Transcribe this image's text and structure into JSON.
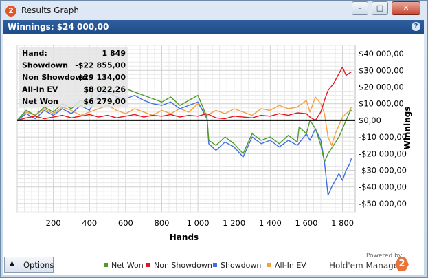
{
  "window": {
    "title": "Results Graph",
    "icon_text": "2",
    "minimize": "–",
    "maximize": "□",
    "close": "✕"
  },
  "header": {
    "text": "Winnings: $24 000,00",
    "help": "?"
  },
  "stats": [
    {
      "label": "Hand:",
      "value": "1 849"
    },
    {
      "label": "Showdown",
      "value": "-$22 855,00"
    },
    {
      "label": "Non Showdown",
      "value": "$29 134,00"
    },
    {
      "label": "All-In EV",
      "value": "$8 022,26"
    },
    {
      "label": "Net Won",
      "value": "$6 279,00"
    }
  ],
  "options": {
    "label": "Options",
    "arrow": "▲"
  },
  "brand": {
    "powered_by": "Powered by",
    "name": "Hold'em Manager",
    "icon": "2"
  },
  "colors": {
    "net_won": "#4f9a2e",
    "non_showdown": "#e8141b",
    "showdown": "#3d6fe0",
    "all_in_ev": "#f5a141"
  },
  "chart_data": {
    "type": "line",
    "xlabel": "Hands",
    "ylabel": "Winnings",
    "xlim": [
      0,
      1870
    ],
    "ylim": [
      -55000,
      45000
    ],
    "x_ticks": [
      200,
      400,
      600,
      800,
      1000,
      1200,
      1400,
      1600,
      1800
    ],
    "x_tick_labels": [
      "200",
      "400",
      "600",
      "800",
      "1 000",
      "1 200",
      "1 400",
      "1 600",
      "1 800"
    ],
    "y_ticks": [
      40000,
      30000,
      20000,
      10000,
      0,
      -10000,
      -20000,
      -30000,
      -40000,
      -50000
    ],
    "y_tick_labels": [
      "$40 000,00",
      "$30 000,00",
      "$20 000,00",
      "$10 000,00",
      "$0,00",
      "-$10 000,00",
      "-$20 000,00",
      "-$30 000,00",
      "-$40 000,00",
      "-$50 000,00"
    ],
    "grid": true,
    "legend": "bottom",
    "series": [
      {
        "name": "Net Won",
        "color": "#4f9a2e",
        "x": [
          0,
          50,
          100,
          150,
          200,
          250,
          300,
          350,
          400,
          420,
          450,
          500,
          550,
          600,
          650,
          700,
          750,
          800,
          850,
          900,
          950,
          1000,
          1050,
          1060,
          1100,
          1150,
          1200,
          1250,
          1300,
          1350,
          1400,
          1450,
          1500,
          1550,
          1560,
          1600,
          1620,
          1650,
          1680,
          1700,
          1720,
          1750,
          1780,
          1800,
          1820,
          1840,
          1849
        ],
        "y": [
          0,
          6000,
          3000,
          8000,
          5000,
          10000,
          7000,
          12000,
          9000,
          18000,
          20000,
          18000,
          16000,
          19000,
          17000,
          15000,
          13000,
          11000,
          14000,
          9000,
          12000,
          15000,
          2000,
          -12000,
          -15000,
          -10000,
          -14000,
          -20000,
          -8000,
          -12000,
          -10000,
          -14000,
          -9000,
          -13000,
          -4000,
          -8000,
          0,
          -5000,
          -15000,
          -25000,
          -20000,
          -15000,
          -10000,
          -5000,
          0,
          5000,
          6279
        ]
      },
      {
        "name": "Non Showdown",
        "color": "#e8141b",
        "x": [
          0,
          50,
          100,
          150,
          200,
          250,
          300,
          350,
          400,
          450,
          500,
          550,
          600,
          650,
          700,
          750,
          800,
          850,
          900,
          950,
          1000,
          1050,
          1100,
          1150,
          1200,
          1250,
          1300,
          1350,
          1400,
          1450,
          1500,
          1550,
          1600,
          1620,
          1650,
          1680,
          1700,
          1720,
          1750,
          1780,
          1800,
          1820,
          1849
        ],
        "y": [
          0,
          1500,
          2500,
          1000,
          2000,
          3000,
          1500,
          2500,
          3500,
          2000,
          3000,
          1500,
          2500,
          3500,
          2000,
          3000,
          2500,
          3500,
          2000,
          3000,
          2500,
          4000,
          1500,
          1000,
          2500,
          2000,
          1500,
          3000,
          2500,
          4000,
          3000,
          4500,
          4000,
          2000,
          0,
          5000,
          12000,
          18000,
          22000,
          28000,
          32000,
          27000,
          29134
        ]
      },
      {
        "name": "Showdown",
        "color": "#3d6fe0",
        "x": [
          0,
          50,
          100,
          150,
          200,
          250,
          300,
          350,
          400,
          450,
          500,
          550,
          600,
          650,
          700,
          750,
          800,
          850,
          900,
          950,
          1000,
          1050,
          1060,
          1100,
          1150,
          1200,
          1250,
          1300,
          1350,
          1400,
          1450,
          1500,
          1550,
          1600,
          1620,
          1650,
          1680,
          1700,
          1720,
          1740,
          1760,
          1780,
          1800,
          1820,
          1840,
          1849
        ],
        "y": [
          0,
          4000,
          1000,
          6000,
          3000,
          7000,
          4000,
          9000,
          6000,
          15000,
          17000,
          14000,
          13000,
          15000,
          12000,
          10000,
          9000,
          11000,
          7000,
          9000,
          11000,
          1000,
          -14000,
          -18000,
          -13000,
          -16000,
          -22000,
          -10000,
          -14000,
          -12000,
          -16000,
          -12000,
          -15000,
          -8000,
          -12000,
          -5000,
          -12000,
          -25000,
          -45000,
          -40000,
          -36000,
          -32000,
          -36000,
          -30000,
          -26000,
          -22855
        ]
      },
      {
        "name": "All-In EV",
        "color": "#f5a141",
        "x": [
          0,
          50,
          100,
          150,
          200,
          250,
          300,
          350,
          400,
          450,
          500,
          550,
          600,
          650,
          700,
          750,
          800,
          850,
          900,
          950,
          1000,
          1050,
          1100,
          1150,
          1200,
          1250,
          1300,
          1350,
          1400,
          1450,
          1500,
          1550,
          1600,
          1620,
          1650,
          1680,
          1700,
          1720,
          1740,
          1760,
          1780,
          1800,
          1820,
          1840,
          1849
        ],
        "y": [
          0,
          5000,
          3000,
          7000,
          4000,
          8000,
          6000,
          3000,
          5000,
          7000,
          9000,
          6000,
          4000,
          7000,
          5000,
          3000,
          6000,
          4000,
          7000,
          5000,
          10000,
          3000,
          6000,
          4000,
          7000,
          5000,
          3000,
          7000,
          6000,
          9000,
          7000,
          8000,
          12000,
          5000,
          14000,
          10000,
          4000,
          -10000,
          -15000,
          -8000,
          -3000,
          2000,
          4000,
          6000,
          8022
        ]
      }
    ]
  }
}
